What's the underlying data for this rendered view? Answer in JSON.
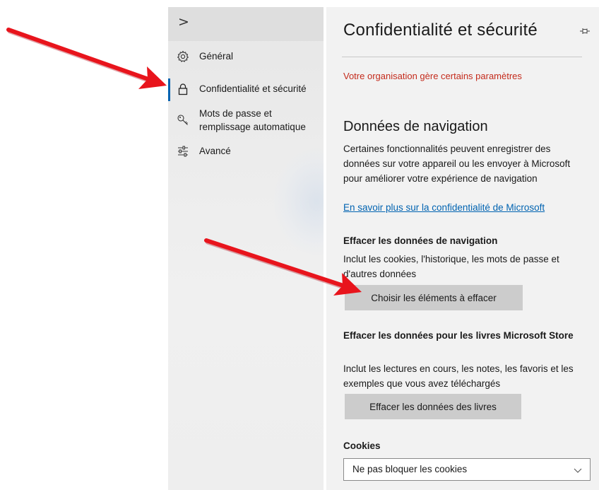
{
  "nav": {
    "expand_glyph": ">",
    "items": [
      {
        "label": "Général",
        "icon": "gear-icon"
      },
      {
        "label": "Confidentialité et sécurité",
        "icon": "lock-icon",
        "active": true
      },
      {
        "label_line1": "Mots de passe et",
        "label_line2": "remplissage automatique",
        "icon": "key-icon"
      },
      {
        "label": "Avancé",
        "icon": "sliders-icon"
      }
    ]
  },
  "pane": {
    "title": "Confidentialité et sécurité",
    "pin_icon": "pin-icon",
    "org_message": "Votre organisation gère certains paramètres",
    "browsing_data": {
      "title": "Données de navigation",
      "description": "Certaines fonctionnalités peuvent enregistrer des données sur votre appareil ou les envoyer à Microsoft pour améliorer votre expérience de navigation",
      "link": "En savoir plus sur la confidentialité de Microsoft"
    },
    "clear_browsing": {
      "heading": "Effacer les données de navigation",
      "description": "Inclut les cookies, l'historique, les mots de passe et d'autres données",
      "button": "Choisir les éléments à effacer"
    },
    "clear_books": {
      "heading": "Effacer les données pour les livres Microsoft Store",
      "description": "Inclut les lectures en cours, les notes, les favoris et les exemples que vous avez téléchargés",
      "button": "Effacer les données des livres"
    },
    "cookies": {
      "heading": "Cookies",
      "selected": "Ne pas bloquer les cookies"
    }
  },
  "colors": {
    "accent": "#0063b1",
    "warning_text": "#c42b1c",
    "annotation_arrow": "#e8141c"
  }
}
